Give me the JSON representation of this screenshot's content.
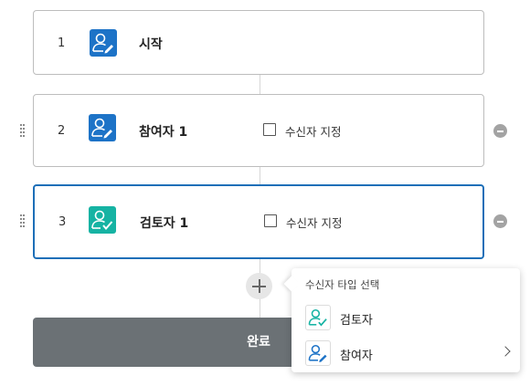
{
  "steps": [
    {
      "number": "1",
      "title": "시작",
      "icon": "user-edit-icon",
      "icon_color": "#1d73c7"
    },
    {
      "number": "2",
      "title": "참여자 1",
      "icon": "user-edit-icon",
      "icon_color": "#1d73c7",
      "checkbox_label": "수신자 지정",
      "checked": false
    },
    {
      "number": "3",
      "title": "검토자 1",
      "icon": "user-check-icon",
      "icon_color": "#16b3a3",
      "checkbox_label": "수신자 지정",
      "checked": false,
      "selected": true
    }
  ],
  "done_button": {
    "label": "완료"
  },
  "recipient_type_menu": {
    "title": "수신자 타입 선택",
    "items": [
      {
        "label": "검토자",
        "icon": "user-check-icon",
        "icon_color": "#16b3a3"
      },
      {
        "label": "참여자",
        "icon": "user-edit-icon",
        "icon_color": "#1d73c7",
        "has_submenu": true
      }
    ]
  },
  "colors": {
    "accent": "#1d6fb8",
    "done_button_bg": "#6b7175"
  }
}
